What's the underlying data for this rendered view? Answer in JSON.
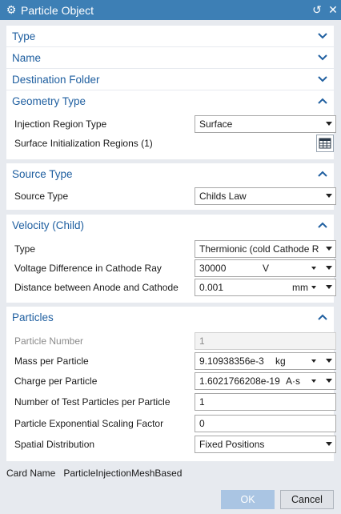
{
  "window": {
    "title": "Particle Object"
  },
  "sections": {
    "type": {
      "title": "Type"
    },
    "name": {
      "title": "Name"
    },
    "destination": {
      "title": "Destination Folder"
    },
    "geometry": {
      "title": "Geometry Type",
      "injection_label": "Injection Region Type",
      "injection_value": "Surface",
      "surface_regions_label": "Surface Initialization Regions (1)"
    },
    "source": {
      "title": "Source Type",
      "source_label": "Source Type",
      "source_value": "Childs Law"
    },
    "velocity": {
      "title": "Velocity (Child)",
      "type_label": "Type",
      "type_value": "Thermionic (cold Cathode R",
      "voltage_label": "Voltage Difference in Cathode Ray",
      "voltage_value": "30000",
      "voltage_unit": "V",
      "distance_label": "Distance between Anode and Cathode",
      "distance_value": "0.001",
      "distance_unit": "mm"
    },
    "particles": {
      "title": "Particles",
      "number_label": "Particle Number",
      "number_value": "1",
      "mass_label": "Mass per Particle",
      "mass_value": "9.10938356e-3",
      "mass_unit": "kg",
      "charge_label": "Charge per Particle",
      "charge_value": "1.6021766208e-19",
      "charge_unit": "A·s",
      "test_label": "Number of Test Particles per Particle",
      "test_value": "1",
      "scaling_label": "Particle Exponential Scaling Factor",
      "scaling_value": "0",
      "spatial_label": "Spatial Distribution",
      "spatial_value": "Fixed Positions"
    }
  },
  "card": {
    "label": "Card Name",
    "value": "ParticleInjectionMeshBased"
  },
  "buttons": {
    "ok": "OK",
    "cancel": "Cancel"
  },
  "colors": {
    "titlebar": "#3d7fb5",
    "section_title": "#1f5fa0",
    "ok_button": "#aac5e3"
  }
}
